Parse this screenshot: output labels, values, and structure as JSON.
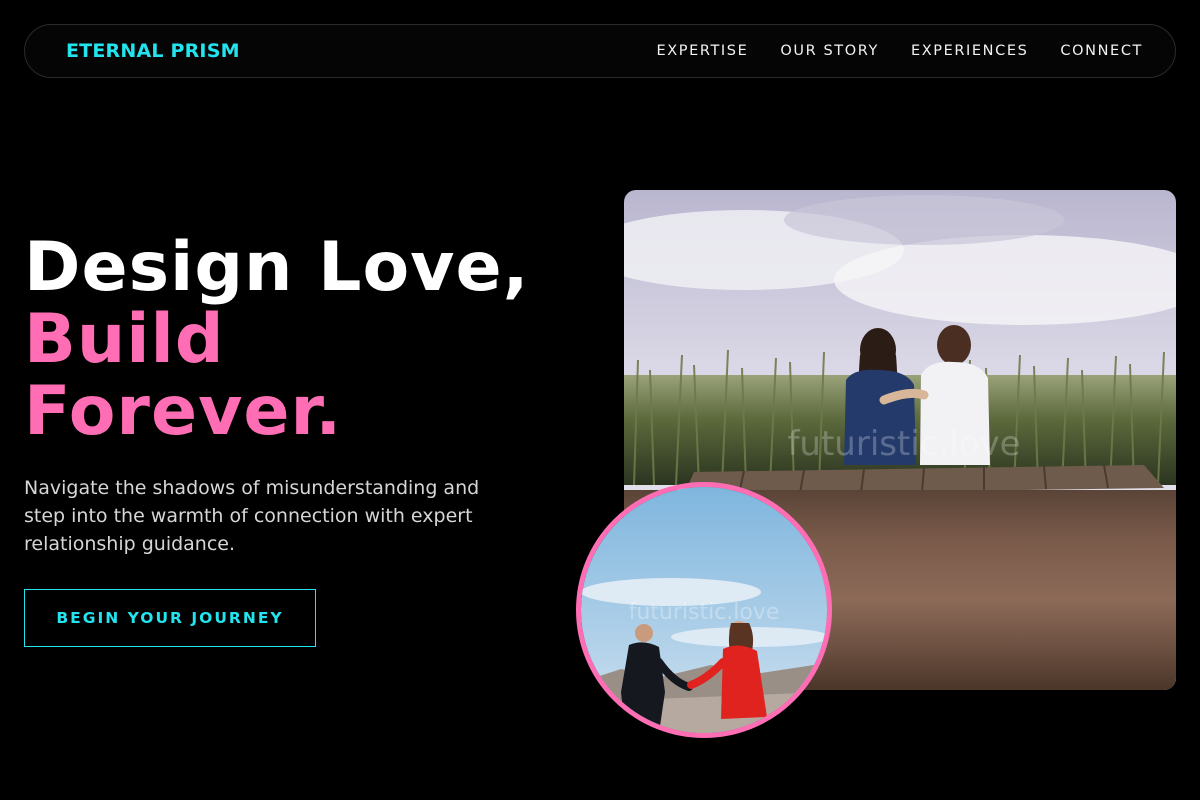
{
  "brand": {
    "name": "ETERNAL PRISM"
  },
  "nav": {
    "links": [
      "EXPERTISE",
      "OUR STORY",
      "EXPERIENCES",
      "CONNECT"
    ]
  },
  "hero": {
    "title_line1": "Design Love,",
    "title_line2": "Build",
    "title_line3": "Forever.",
    "subtitle": "Navigate the shadows of misunderstanding and step into the warmth of connection with expert relationship guidance.",
    "cta_label": "BEGIN YOUR JOURNEY"
  },
  "images": {
    "main_watermark": "futuristic.love",
    "circle_watermark": "futuristic.love"
  },
  "colors": {
    "accent_cyan": "#22e3ee",
    "accent_pink": "#ff6eb4",
    "background": "#000000"
  }
}
